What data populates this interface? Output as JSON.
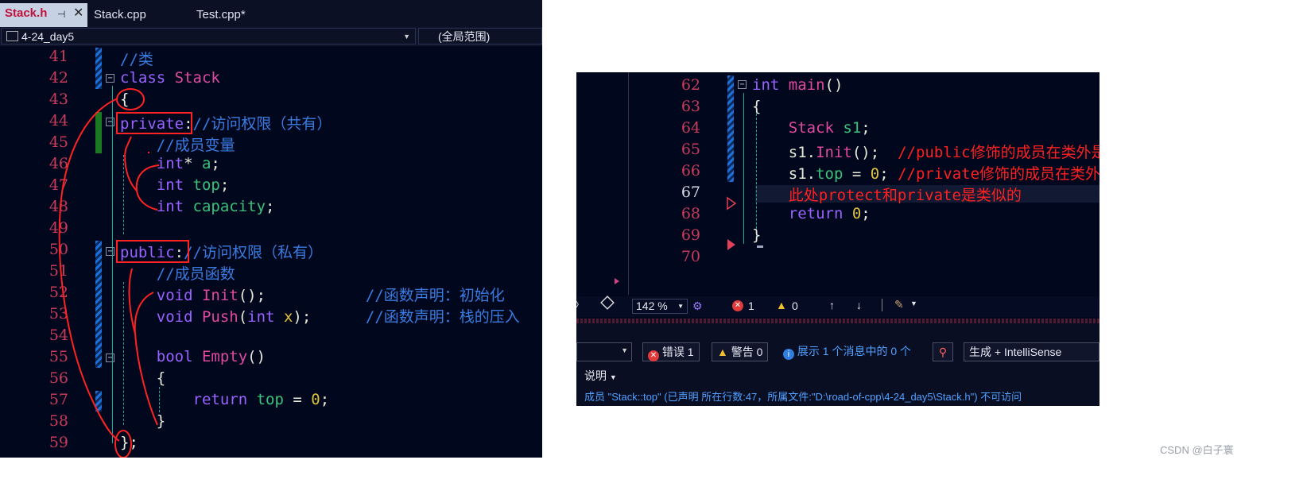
{
  "tabs": [
    {
      "label": "Stack.h",
      "pin": "⊣",
      "close": "✕"
    },
    {
      "label": "Stack.cpp"
    },
    {
      "label": "Test.cpp*"
    }
  ],
  "nav": {
    "project": "4-24_day5",
    "scope": "(全局范围)"
  },
  "left_lines": [
    {
      "n": "41",
      "code": [
        {
          "t": "//类",
          "c": "cmt"
        }
      ]
    },
    {
      "n": "42",
      "code": [
        {
          "t": "class ",
          "c": "kw"
        },
        {
          "t": "Stack",
          "c": "fn"
        }
      ]
    },
    {
      "n": "43",
      "code": [
        {
          "t": "{",
          "c": "plain"
        }
      ]
    },
    {
      "n": "44",
      "code": [
        {
          "t": "private",
          "c": "kw"
        },
        {
          "t": ":",
          "c": "plain"
        },
        {
          "t": "//访问权限（共有）",
          "c": "cmt"
        }
      ]
    },
    {
      "n": "45",
      "code": [
        {
          "t": "    //成员变量",
          "c": "cmt"
        }
      ]
    },
    {
      "n": "46",
      "code": [
        {
          "t": "    int",
          "c": "kw"
        },
        {
          "t": "* ",
          "c": "plain"
        },
        {
          "t": "a",
          "c": "var"
        },
        {
          "t": ";",
          "c": "plain"
        }
      ]
    },
    {
      "n": "47",
      "code": [
        {
          "t": "    int ",
          "c": "kw"
        },
        {
          "t": "top",
          "c": "var"
        },
        {
          "t": ";",
          "c": "plain"
        }
      ]
    },
    {
      "n": "48",
      "code": [
        {
          "t": "    int ",
          "c": "kw"
        },
        {
          "t": "capacity",
          "c": "var"
        },
        {
          "t": ";",
          "c": "plain"
        }
      ]
    },
    {
      "n": "49",
      "code": []
    },
    {
      "n": "50",
      "code": [
        {
          "t": "public",
          "c": "kw"
        },
        {
          "t": ":",
          "c": "plain"
        },
        {
          "t": "//访问权限（私有）",
          "c": "cmt"
        }
      ]
    },
    {
      "n": "51",
      "code": [
        {
          "t": "    //成员函数",
          "c": "cmt"
        }
      ]
    },
    {
      "n": "52",
      "code": [
        {
          "t": "    void ",
          "c": "kw"
        },
        {
          "t": "Init",
          "c": "fn"
        },
        {
          "t": "();",
          "c": "plain"
        },
        {
          "t": "           //函数声明：初始化",
          "c": "cmt"
        }
      ]
    },
    {
      "n": "53",
      "code": [
        {
          "t": "    void ",
          "c": "kw"
        },
        {
          "t": "Push",
          "c": "fn"
        },
        {
          "t": "(",
          "c": "plain"
        },
        {
          "t": "int ",
          "c": "kw"
        },
        {
          "t": "x",
          "c": "num"
        },
        {
          "t": ");",
          "c": "plain"
        },
        {
          "t": "      //函数声明：栈的压入",
          "c": "cmt"
        }
      ]
    },
    {
      "n": "54",
      "code": []
    },
    {
      "n": "55",
      "code": [
        {
          "t": "    bool ",
          "c": "kw"
        },
        {
          "t": "Empty",
          "c": "fn"
        },
        {
          "t": "()",
          "c": "plain"
        }
      ]
    },
    {
      "n": "56",
      "code": [
        {
          "t": "    {",
          "c": "plain"
        }
      ]
    },
    {
      "n": "57",
      "code": [
        {
          "t": "        return ",
          "c": "kw"
        },
        {
          "t": "top",
          "c": "var"
        },
        {
          "t": " = ",
          "c": "plain"
        },
        {
          "t": "0",
          "c": "num"
        },
        {
          "t": ";",
          "c": "plain"
        }
      ]
    },
    {
      "n": "58",
      "code": [
        {
          "t": "    }",
          "c": "plain"
        }
      ]
    },
    {
      "n": "59",
      "code": [
        {
          "t": "};",
          "c": "plain"
        }
      ]
    }
  ],
  "right_lines": [
    {
      "n": "62",
      "code": [
        {
          "t": "int ",
          "c": "kw"
        },
        {
          "t": "main",
          "c": "fn"
        },
        {
          "t": "()",
          "c": "plain"
        }
      ]
    },
    {
      "n": "63",
      "code": [
        {
          "t": "{",
          "c": "plain"
        }
      ]
    },
    {
      "n": "64",
      "code": [
        {
          "t": "    Stack ",
          "c": "fn"
        },
        {
          "t": "s1",
          "c": "var"
        },
        {
          "t": ";",
          "c": "plain"
        }
      ]
    },
    {
      "n": "65",
      "code": [
        {
          "t": "    s1",
          "c": "plain"
        },
        {
          "t": ".",
          "c": "plain"
        },
        {
          "t": "Init",
          "c": "fn"
        },
        {
          "t": "();  ",
          "c": "plain"
        },
        {
          "t": "//public修饰的成员在类外是直接可以访问",
          "c": "cmtred"
        }
      ]
    },
    {
      "n": "66",
      "code": [
        {
          "t": "    s1",
          "c": "plain"
        },
        {
          "t": ".",
          "c": "plain"
        },
        {
          "t": "top",
          "c": "var"
        },
        {
          "t": " = ",
          "c": "plain"
        },
        {
          "t": "0",
          "c": "num"
        },
        {
          "t": "; ",
          "c": "plain"
        },
        {
          "t": "//private修饰的成员在类外不能直接被访问",
          "c": "cmtred"
        }
      ]
    },
    {
      "n": "67",
      "code": [
        {
          "t": "    此处protect和private是类似的",
          "c": "cmtred"
        }
      ]
    },
    {
      "n": "68",
      "code": [
        {
          "t": "    return ",
          "c": "kw"
        },
        {
          "t": "0",
          "c": "num"
        },
        {
          "t": ";",
          "c": "plain"
        }
      ]
    },
    {
      "n": "69",
      "code": [
        {
          "t": "}",
          "c": "plain"
        }
      ]
    },
    {
      "n": "70",
      "code": []
    }
  ],
  "statusbar": {
    "zoom": "142 %",
    "errors": "1",
    "warnings": "0"
  },
  "error_list": {
    "errors_label": "错误 1",
    "warnings_label": "警告 0",
    "messages_label": "展示 1 个消息中的 0 个",
    "build_filter": "生成 + IntelliSense",
    "column_header": "说明",
    "message": "成员 \"Stack::top\" (已声明 所在行数:47，所属文件:\"D:\\road-of-cpp\\4-24_day5\\Stack.h\") 不可访问"
  },
  "watermark": "CSDN @白子寰",
  "colors": {
    "editor_bg": "#01081e",
    "annotation": "#ff2222",
    "line_number": "#c93b5b"
  }
}
